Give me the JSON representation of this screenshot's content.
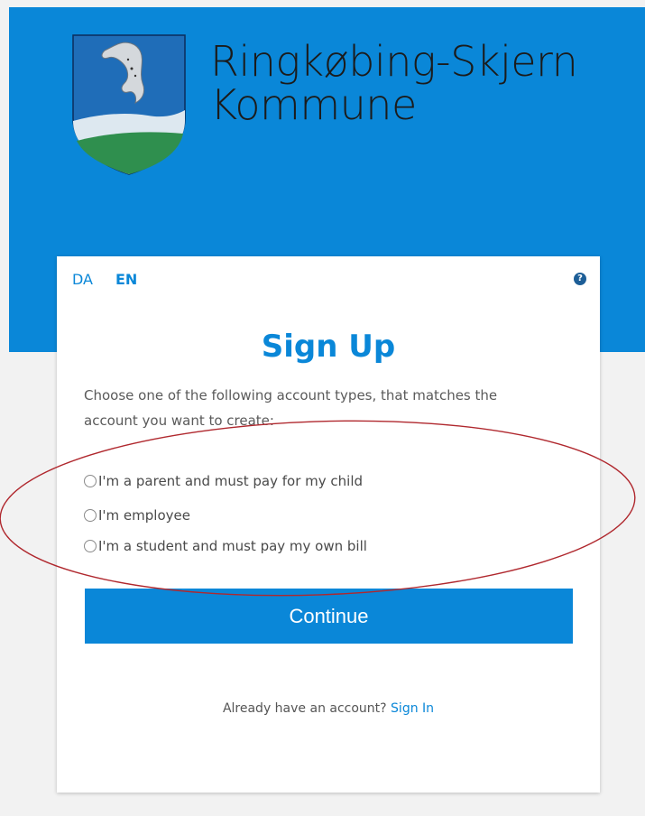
{
  "header": {
    "brand_line1": "Ringkøbing-Skjern",
    "brand_line2": "Kommune",
    "colors": {
      "band": "#0a87d8",
      "brand_text": "#1b1b1b"
    }
  },
  "language": {
    "da": "DA",
    "en": "EN",
    "active": "EN"
  },
  "help_icon": "question-circle-icon",
  "form": {
    "title": "Sign Up",
    "intro": "Choose one of the following account types, that matches the account you want to create:",
    "options": [
      {
        "label": "I'm a parent and must pay for my child",
        "selected": false
      },
      {
        "label": "I'm employee",
        "selected": false
      },
      {
        "label": "I'm a student and must pay my own bill",
        "selected": false
      }
    ],
    "continue_label": "Continue",
    "signin_prompt": "Already have an account?",
    "signin_link": "Sign In"
  },
  "annotation": {
    "shape": "ellipse",
    "color": "#b0282e"
  }
}
